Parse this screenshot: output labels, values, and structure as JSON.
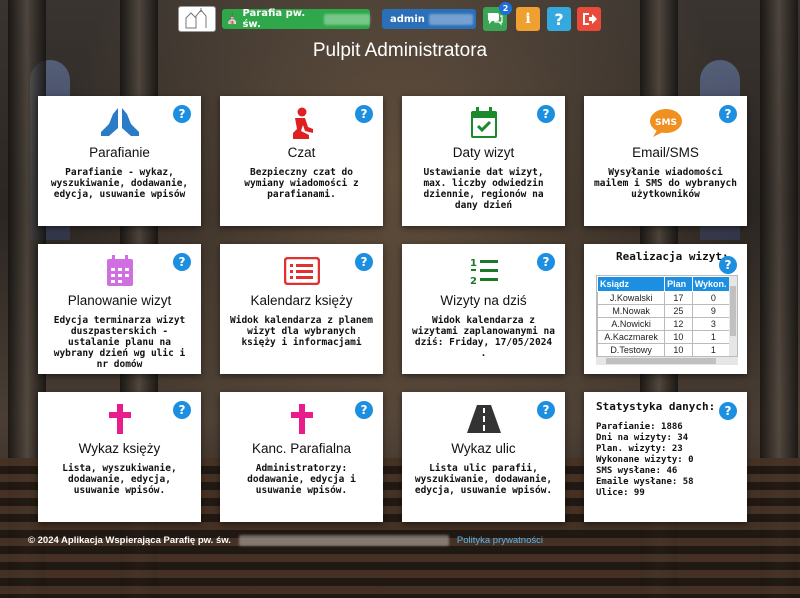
{
  "topbar": {
    "parish_label": "Parafia pw. św.",
    "admin_label": "admin",
    "chat_badge": "2",
    "info_glyph": "i",
    "help_glyph": "?",
    "icons": [
      "church-logo-icon",
      "church-icon",
      "chat-icon",
      "info-icon",
      "help-icon",
      "logout-icon"
    ]
  },
  "page_title": "Pulpit Administratora",
  "cards": {
    "parafianie": {
      "title": "Parafianie",
      "desc": "Parafianie - wykaz, wyszukiwanie, dodawanie, edycja, usuwanie wpisów",
      "icon": "praying-hands-icon",
      "color": "#2a7bc8"
    },
    "czat": {
      "title": "Czat",
      "desc": "Bezpieczny czat do wymiany wiadomości z parafianami.",
      "icon": "praying-person-icon",
      "color": "#e02020"
    },
    "daty": {
      "title": "Daty wizyt",
      "desc": "Ustawianie dat wizyt, max. liczby odwiedzin dziennie, regionów na dany dzień",
      "icon": "calendar-check-icon",
      "color": "#1a8a2a"
    },
    "email": {
      "title": "Email/SMS",
      "desc": "Wysyłanie wiadomości mailem i SMS do wybranych użytkowników",
      "icon": "sms-bubble-icon",
      "color": "#f09020",
      "sms": "SMS"
    },
    "planowanie": {
      "title": "Planowanie wizyt",
      "desc": "Edycja terminarza wizyt duszpasterskich - ustalanie planu na wybrany dzień wg ulic i nr domów",
      "icon": "calendar-icon",
      "color": "#d070e0"
    },
    "kalendarz": {
      "title": "Kalendarz księży",
      "desc": "Widok kalendarza z planem wizyt dla wybranych księży i informacjami",
      "icon": "list-icon",
      "color": "#e03030"
    },
    "wizyty": {
      "title": "Wizyty na dziś",
      "desc": "Widok kalendarza z wizytami zaplanowanymi na dziś: Friday, 17/05/2024 .",
      "icon": "numbered-list-icon",
      "color": "#1a7a2a"
    },
    "wykaz": {
      "title": "Wykaz księży",
      "desc": "Lista, wyszukiwanie, dodawanie, edycja, usuwanie wpisów.",
      "icon": "cross-icon",
      "color": "#e81c8c"
    },
    "kanc": {
      "title": "Kanc. Parafialna",
      "desc": "Administratorzy: dodawanie, edycja i usuwanie wpisów.",
      "icon": "cross-icon",
      "color": "#e81c8c"
    },
    "ulice": {
      "title": "Wykaz ulic",
      "desc": "Lista ulic parafii, wyszukiwanie, dodawanie, edycja, usuwanie wpisów.",
      "icon": "road-icon",
      "color": "#333333"
    }
  },
  "realizacja": {
    "title": "Realizacja wizyt:",
    "headers": [
      "Ksiądz",
      "Plan",
      "Wykon."
    ],
    "rows": [
      [
        "J.Kowalski",
        "17",
        "0"
      ],
      [
        "M.Nowak",
        "25",
        "9"
      ],
      [
        "A.Nowicki",
        "12",
        "3"
      ],
      [
        "A.Kaczmarek",
        "10",
        "1"
      ],
      [
        "D.Testowy",
        "10",
        "1"
      ]
    ]
  },
  "statystyka": {
    "title": "Statystyka danych:",
    "lines": [
      "Parafianie: 1886",
      "Dni na wizyty: 34",
      "Plan. wizyty: 23",
      "Wykonane wizyty: 0",
      "SMS wysłane: 46",
      "Emaile wysłane: 58",
      "Ulice: 99"
    ]
  },
  "help_glyph": "?",
  "footer": {
    "copyright": "© 2024 Aplikacja Wspierająca Parafię pw. św.",
    "privacy_link": "Polityka prywatności"
  }
}
